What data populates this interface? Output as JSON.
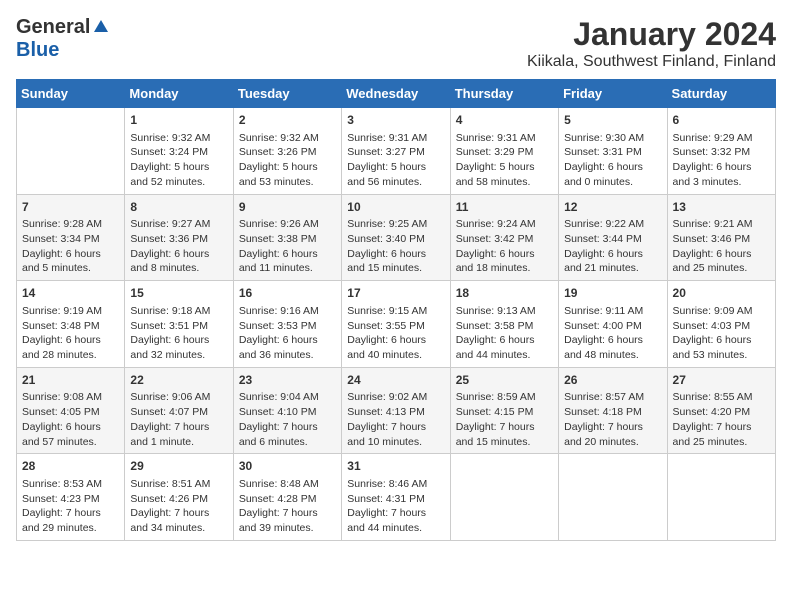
{
  "header": {
    "logo_general": "General",
    "logo_blue": "Blue",
    "title": "January 2024",
    "subtitle": "Kiikala, Southwest Finland, Finland"
  },
  "calendar": {
    "days_of_week": [
      "Sunday",
      "Monday",
      "Tuesday",
      "Wednesday",
      "Thursday",
      "Friday",
      "Saturday"
    ],
    "weeks": [
      [
        {
          "day": "",
          "content": ""
        },
        {
          "day": "1",
          "content": "Sunrise: 9:32 AM\nSunset: 3:24 PM\nDaylight: 5 hours\nand 52 minutes."
        },
        {
          "day": "2",
          "content": "Sunrise: 9:32 AM\nSunset: 3:26 PM\nDaylight: 5 hours\nand 53 minutes."
        },
        {
          "day": "3",
          "content": "Sunrise: 9:31 AM\nSunset: 3:27 PM\nDaylight: 5 hours\nand 56 minutes."
        },
        {
          "day": "4",
          "content": "Sunrise: 9:31 AM\nSunset: 3:29 PM\nDaylight: 5 hours\nand 58 minutes."
        },
        {
          "day": "5",
          "content": "Sunrise: 9:30 AM\nSunset: 3:31 PM\nDaylight: 6 hours\nand 0 minutes."
        },
        {
          "day": "6",
          "content": "Sunrise: 9:29 AM\nSunset: 3:32 PM\nDaylight: 6 hours\nand 3 minutes."
        }
      ],
      [
        {
          "day": "7",
          "content": "Sunrise: 9:28 AM\nSunset: 3:34 PM\nDaylight: 6 hours\nand 5 minutes."
        },
        {
          "day": "8",
          "content": "Sunrise: 9:27 AM\nSunset: 3:36 PM\nDaylight: 6 hours\nand 8 minutes."
        },
        {
          "day": "9",
          "content": "Sunrise: 9:26 AM\nSunset: 3:38 PM\nDaylight: 6 hours\nand 11 minutes."
        },
        {
          "day": "10",
          "content": "Sunrise: 9:25 AM\nSunset: 3:40 PM\nDaylight: 6 hours\nand 15 minutes."
        },
        {
          "day": "11",
          "content": "Sunrise: 9:24 AM\nSunset: 3:42 PM\nDaylight: 6 hours\nand 18 minutes."
        },
        {
          "day": "12",
          "content": "Sunrise: 9:22 AM\nSunset: 3:44 PM\nDaylight: 6 hours\nand 21 minutes."
        },
        {
          "day": "13",
          "content": "Sunrise: 9:21 AM\nSunset: 3:46 PM\nDaylight: 6 hours\nand 25 minutes."
        }
      ],
      [
        {
          "day": "14",
          "content": "Sunrise: 9:19 AM\nSunset: 3:48 PM\nDaylight: 6 hours\nand 28 minutes."
        },
        {
          "day": "15",
          "content": "Sunrise: 9:18 AM\nSunset: 3:51 PM\nDaylight: 6 hours\nand 32 minutes."
        },
        {
          "day": "16",
          "content": "Sunrise: 9:16 AM\nSunset: 3:53 PM\nDaylight: 6 hours\nand 36 minutes."
        },
        {
          "day": "17",
          "content": "Sunrise: 9:15 AM\nSunset: 3:55 PM\nDaylight: 6 hours\nand 40 minutes."
        },
        {
          "day": "18",
          "content": "Sunrise: 9:13 AM\nSunset: 3:58 PM\nDaylight: 6 hours\nand 44 minutes."
        },
        {
          "day": "19",
          "content": "Sunrise: 9:11 AM\nSunset: 4:00 PM\nDaylight: 6 hours\nand 48 minutes."
        },
        {
          "day": "20",
          "content": "Sunrise: 9:09 AM\nSunset: 4:03 PM\nDaylight: 6 hours\nand 53 minutes."
        }
      ],
      [
        {
          "day": "21",
          "content": "Sunrise: 9:08 AM\nSunset: 4:05 PM\nDaylight: 6 hours\nand 57 minutes."
        },
        {
          "day": "22",
          "content": "Sunrise: 9:06 AM\nSunset: 4:07 PM\nDaylight: 7 hours\nand 1 minute."
        },
        {
          "day": "23",
          "content": "Sunrise: 9:04 AM\nSunset: 4:10 PM\nDaylight: 7 hours\nand 6 minutes."
        },
        {
          "day": "24",
          "content": "Sunrise: 9:02 AM\nSunset: 4:13 PM\nDaylight: 7 hours\nand 10 minutes."
        },
        {
          "day": "25",
          "content": "Sunrise: 8:59 AM\nSunset: 4:15 PM\nDaylight: 7 hours\nand 15 minutes."
        },
        {
          "day": "26",
          "content": "Sunrise: 8:57 AM\nSunset: 4:18 PM\nDaylight: 7 hours\nand 20 minutes."
        },
        {
          "day": "27",
          "content": "Sunrise: 8:55 AM\nSunset: 4:20 PM\nDaylight: 7 hours\nand 25 minutes."
        }
      ],
      [
        {
          "day": "28",
          "content": "Sunrise: 8:53 AM\nSunset: 4:23 PM\nDaylight: 7 hours\nand 29 minutes."
        },
        {
          "day": "29",
          "content": "Sunrise: 8:51 AM\nSunset: 4:26 PM\nDaylight: 7 hours\nand 34 minutes."
        },
        {
          "day": "30",
          "content": "Sunrise: 8:48 AM\nSunset: 4:28 PM\nDaylight: 7 hours\nand 39 minutes."
        },
        {
          "day": "31",
          "content": "Sunrise: 8:46 AM\nSunset: 4:31 PM\nDaylight: 7 hours\nand 44 minutes."
        },
        {
          "day": "",
          "content": ""
        },
        {
          "day": "",
          "content": ""
        },
        {
          "day": "",
          "content": ""
        }
      ]
    ]
  }
}
